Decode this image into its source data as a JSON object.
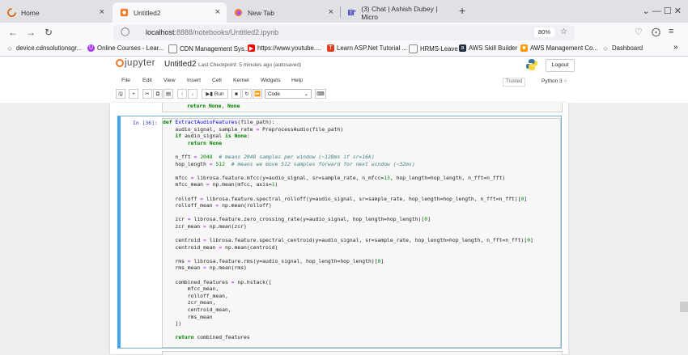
{
  "browser": {
    "tabs": [
      {
        "title": "Home",
        "icon": "loading-icon"
      },
      {
        "title": "Untitled2",
        "icon": "jupyter-favicon-icon"
      },
      {
        "title": "New Tab",
        "icon": "firefox-icon"
      },
      {
        "title": "(3) Chat | Ashish Dubey | Micro",
        "icon": "teams-icon"
      }
    ],
    "active_tab": 1,
    "new_tab_symbol": "+",
    "close_symbol": "×",
    "window_controls": "⌄  —  ☐  ✕",
    "url_host": "localhost",
    "url_path": ":8888/notebooks/Untitled2.ipynb",
    "zoom": "80%",
    "bookmarks": [
      {
        "label": "device.cdnsolutionsgr...",
        "icon": "globe-icon",
        "color": "#666666"
      },
      {
        "label": "Online Courses - Lear...",
        "icon": "udemy-icon",
        "color": "#a435f0"
      },
      {
        "label": "CDN Management Sys...",
        "icon": "page-icon",
        "color": "#888888"
      },
      {
        "label": "https://www.youtube....",
        "icon": "youtube-icon",
        "color": "#ff0000"
      },
      {
        "label": "Learn ASP.Net Tutorial ...",
        "icon": "tutorial-icon",
        "color": "#e04020"
      },
      {
        "label": "HRMS-Leave",
        "icon": "page-icon",
        "color": "#888888"
      },
      {
        "label": "AWS Skill Builder",
        "icon": "aws-icon",
        "color": "#232f3e"
      },
      {
        "label": "AWS Management Co...",
        "icon": "aws-console-icon",
        "color": "#ff9900"
      },
      {
        "label": "Dashboard",
        "icon": "globe-icon",
        "color": "#666666"
      }
    ],
    "bookmarks_overflow": "»"
  },
  "jupyter": {
    "logo_text": "jupyter",
    "notebook_name": "Untitled2",
    "checkpoint": "Last Checkpoint: 5 minutes ago  (autosaved)",
    "logout_label": "Logout",
    "menu": [
      "File",
      "Edit",
      "View",
      "Insert",
      "Cell",
      "Kernel",
      "Widgets",
      "Help"
    ],
    "trusted_label": "Trusted",
    "kernel_label": "Python 3",
    "toolbar": {
      "run_label": "Run",
      "cell_type": "Code"
    }
  },
  "notebook": {
    "previous_cell_tail": "return None, None",
    "cell": {
      "prompt": "In [36]:",
      "code_lines": [
        "def ExtractAudioFeatures(file_path):",
        "    audio_signal, sample_rate = PreprocessAudio(file_path)",
        "    if audio_signal is None:",
        "        return None",
        "",
        "    n_fft = 2048  # means 2048 samples per window (~128ms if sr=16k)",
        "    hop_length = 512  # means we move 512 samples forward for next window (~32ms)",
        "",
        "    mfcc = librosa.feature.mfcc(y=audio_signal, sr=sample_rate, n_mfcc=13, hop_length=hop_length, n_fft=n_fft)",
        "    mfcc_mean = np.mean(mfcc, axis=1)",
        "",
        "    rolloff = librosa.feature.spectral_rolloff(y=audio_signal, sr=sample_rate, hop_length=hop_length, n_fft=n_fft)[0]",
        "    rolloff_mean = np.mean(rolloff)",
        "",
        "    zcr = librosa.feature.zero_crossing_rate(y=audio_signal, hop_length=hop_length)[0]",
        "    zcr_mean = np.mean(zcr)",
        "",
        "    centroid = librosa.feature.spectral_centroid(y=audio_signal, sr=sample_rate, hop_length=hop_length, n_fft=n_fft)[0]",
        "    centroid_mean = np.mean(centroid)",
        "",
        "    rms = librosa.feature.rms(y=audio_signal, hop_length=hop_length)[0]",
        "    rms_mean = np.mean(rms)",
        "",
        "    combined_features = np.hstack([",
        "        mfcc_mean,",
        "        rolloff_mean,",
        "        zcr_mean,",
        "        centroid_mean,",
        "        rms_mean",
        "    ])",
        "",
        "    return combined_features"
      ]
    }
  },
  "colors": {
    "accent": "#42a5f5",
    "jupyter_orange": "#f37726",
    "keyword": "#008000",
    "function": "#0000ff"
  }
}
